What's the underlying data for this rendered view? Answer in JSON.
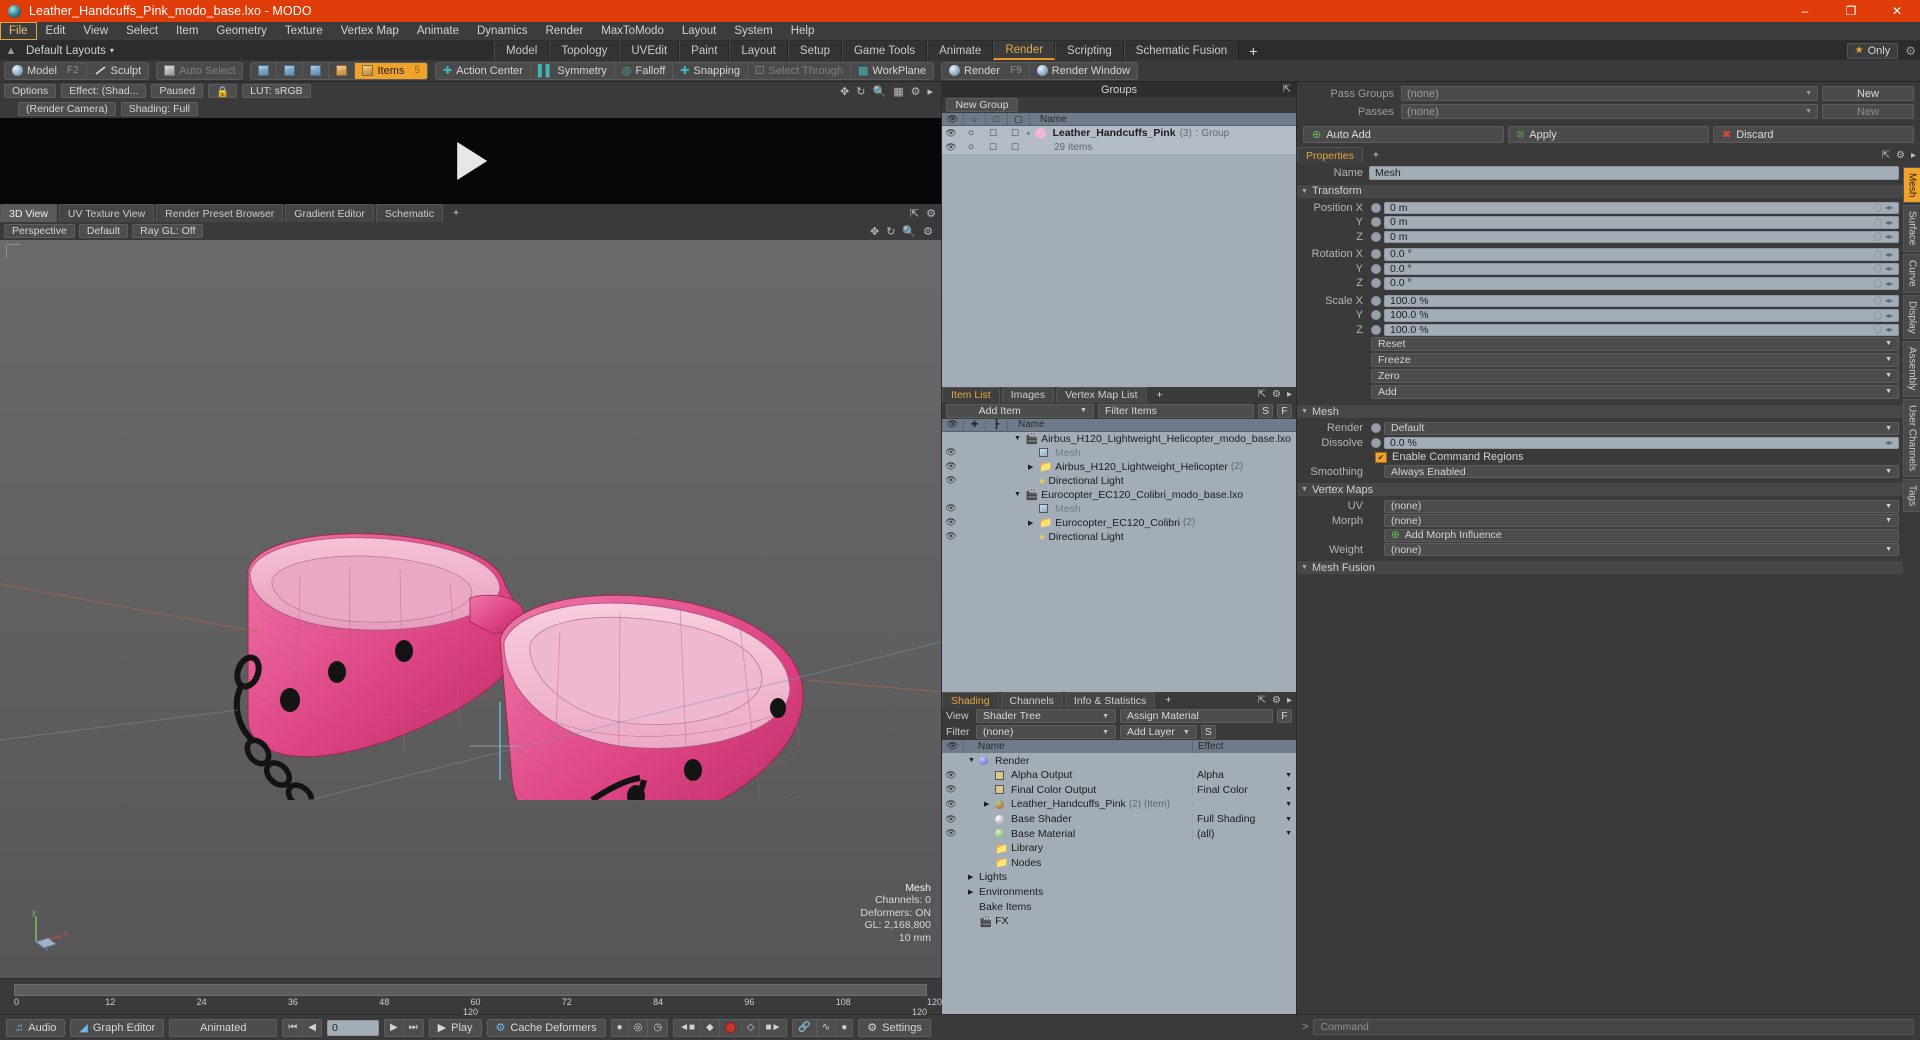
{
  "window": {
    "title": "Leather_Handcuffs_Pink_modo_base.lxo - MODO",
    "minimize": "–",
    "maximize": "❐",
    "close": "✕"
  },
  "menu": {
    "items": [
      "File",
      "Edit",
      "View",
      "Select",
      "Item",
      "Geometry",
      "Texture",
      "Vertex Map",
      "Animate",
      "Dynamics",
      "Render",
      "MaxToModo",
      "Layout",
      "System",
      "Help"
    ],
    "active": "File"
  },
  "layoutbar": {
    "home_icon": "home-icon",
    "label": "Default Layouts",
    "caret": "▾",
    "tabs": [
      "Model",
      "Topology",
      "UVEdit",
      "Paint",
      "Layout",
      "Setup",
      "Game Tools",
      "Animate",
      "Render",
      "Scripting",
      "Schematic Fusion"
    ],
    "selected_tab": "Render",
    "add_tab": "+",
    "only_label": "Only",
    "star": "★",
    "gear": "⚙"
  },
  "modebar": {
    "model": "Model",
    "model_key": "F2",
    "sculpt": "Sculpt",
    "auto_select": "Auto Select",
    "items": "Items",
    "items_key": "5",
    "action_center": "Action Center",
    "symmetry": "Symmetry",
    "falloff": "Falloff",
    "snapping": "Snapping",
    "select_through": "Select Through",
    "workplane": "WorkPlane",
    "render": "Render",
    "render_key": "F9",
    "render_window": "Render Window"
  },
  "preview": {
    "options": "Options",
    "effect": "Effect: (Shad...",
    "paused": "Paused",
    "lut": "LUT: sRGB",
    "render_camera": "(Render Camera)",
    "shading": "Shading: Full",
    "icons": [
      "move-icon",
      "rotate-icon",
      "zoom-icon",
      "grid-icon",
      "gear-icon",
      "arrow-icon"
    ]
  },
  "viewtabs": {
    "tabs": [
      "3D View",
      "UV Texture View",
      "Render Preset Browser",
      "Gradient Editor",
      "Schematic"
    ],
    "selected": "3D View",
    "add": "+"
  },
  "viewportbar": {
    "perspective": "Perspective",
    "default": "Default",
    "raygl": "Ray GL: Off",
    "icons": [
      "move-icon",
      "rotate-icon",
      "zoom-icon",
      "gear-icon"
    ]
  },
  "viewport_stats": {
    "title": "Mesh",
    "channels": "Channels: 0",
    "deformers": "Deformers: ON",
    "gl": "GL: 2,168,800",
    "scale": "10 mm",
    "axis_x": "x",
    "axis_y": "y",
    "axis_z": "z"
  },
  "timeline": {
    "ticks": [
      "0",
      "12",
      "24",
      "36",
      "48",
      "60",
      "72",
      "84",
      "96",
      "108",
      "120"
    ],
    "center_label": "120",
    "right_label": "120"
  },
  "groups_panel": {
    "title": "Groups",
    "new_group": "New Group",
    "columns": {
      "name": "Name"
    },
    "row": {
      "name": "Leather_Handcuffs_Pink",
      "count": "(3)",
      "type": ": Group",
      "sub": "29 Items"
    }
  },
  "item_list": {
    "tabs": [
      "Item List",
      "Images",
      "Vertex Map List"
    ],
    "selected": "Item List",
    "add": "+",
    "add_item": "Add Item",
    "filter_placeholder": "Filter Items",
    "btn_s": "S",
    "btn_f": "F",
    "columns": {
      "name": "Name"
    },
    "rows": [
      {
        "name": "Airbus_H120_Lightweight_Helicopter_modo_base.lxo",
        "kind": "scene",
        "indent": 0,
        "count": "",
        "dim": false,
        "eye": false,
        "tri": "▼"
      },
      {
        "name": "Mesh",
        "kind": "mesh",
        "indent": 1,
        "count": "",
        "dim": true,
        "eye": true,
        "tri": ""
      },
      {
        "name": "Airbus_H120_Lightweight_Helicopter",
        "kind": "folder",
        "indent": 1,
        "count": "(2)",
        "dim": false,
        "eye": true,
        "tri": "▶"
      },
      {
        "name": "Directional Light",
        "kind": "light",
        "indent": 1,
        "count": "",
        "dim": false,
        "eye": true,
        "tri": ""
      },
      {
        "name": "Eurocopter_EC120_Colibri_modo_base.lxo",
        "kind": "scene",
        "indent": 0,
        "count": "",
        "dim": false,
        "eye": false,
        "tri": "▼"
      },
      {
        "name": "Mesh",
        "kind": "mesh",
        "indent": 1,
        "count": "",
        "dim": true,
        "eye": true,
        "tri": ""
      },
      {
        "name": "Eurocopter_EC120_Colibri",
        "kind": "folder",
        "indent": 1,
        "count": "(2)",
        "dim": false,
        "eye": true,
        "tri": "▶"
      },
      {
        "name": "Directional Light",
        "kind": "light",
        "indent": 1,
        "count": "",
        "dim": false,
        "eye": true,
        "tri": ""
      }
    ]
  },
  "shading_panel": {
    "tabs": [
      "Shading",
      "Channels",
      "Info & Statistics"
    ],
    "selected": "Shading",
    "add": "+",
    "view_label": "View",
    "view_value": "Shader Tree",
    "filter_label": "Filter",
    "filter_value": "(none)",
    "assign_material": "Assign Material",
    "add_layer": "Add Layer",
    "btn_f": "F",
    "btn_s": "S",
    "columns": {
      "name": "Name",
      "effect": "Effect"
    },
    "rows": [
      {
        "name": "Render",
        "effect": "",
        "indent": 0,
        "tri": "▼",
        "icon": "sphere-blue",
        "eye": false,
        "suffix": ""
      },
      {
        "name": "Alpha Output",
        "effect": "Alpha",
        "indent": 1,
        "tri": "",
        "icon": "image-out",
        "eye": true,
        "suffix": ""
      },
      {
        "name": "Final Color Output",
        "effect": "Final Color",
        "indent": 1,
        "tri": "",
        "icon": "image-out",
        "eye": true,
        "suffix": ""
      },
      {
        "name": "Leather_Handcuffs_Pink",
        "effect": "",
        "indent": 1,
        "tri": "▶",
        "icon": "sphere-red",
        "eye": true,
        "suffix": "(2) (Item)"
      },
      {
        "name": "Base Shader",
        "effect": "Full Shading",
        "indent": 1,
        "tri": "",
        "icon": "sphere-white",
        "eye": true,
        "suffix": ""
      },
      {
        "name": "Base Material",
        "effect": "(all)",
        "indent": 1,
        "tri": "",
        "icon": "sphere-green",
        "eye": true,
        "suffix": ""
      },
      {
        "name": "Library",
        "effect": "",
        "indent": 1,
        "tri": "",
        "icon": "folder",
        "eye": false,
        "suffix": ""
      },
      {
        "name": "Nodes",
        "effect": "",
        "indent": 1,
        "tri": "",
        "icon": "folder",
        "eye": false,
        "suffix": ""
      },
      {
        "name": "Lights",
        "effect": "",
        "indent": 0,
        "tri": "▶",
        "icon": "",
        "eye": false,
        "suffix": ""
      },
      {
        "name": "Environments",
        "effect": "",
        "indent": 0,
        "tri": "▶",
        "icon": "",
        "eye": false,
        "suffix": ""
      },
      {
        "name": "Bake Items",
        "effect": "",
        "indent": 0,
        "tri": "",
        "icon": "",
        "eye": false,
        "suffix": ""
      },
      {
        "name": "FX",
        "effect": "",
        "indent": 0,
        "tri": "",
        "icon": "clapper",
        "eye": false,
        "suffix": ""
      }
    ]
  },
  "passes": {
    "pass_groups_label": "Pass Groups",
    "pass_groups_value": "(none)",
    "pass_groups_new": "New",
    "passes_label": "Passes",
    "passes_value": "(none)",
    "passes_new": "New",
    "auto_add": "Auto Add",
    "apply": "Apply",
    "discard": "Discard"
  },
  "properties": {
    "tabs": [
      "Properties"
    ],
    "selected": "Properties",
    "add": "+",
    "name_label": "Name",
    "name_value": "Mesh",
    "transform_header": "Transform",
    "transform_rows": [
      {
        "label": "Position X",
        "value": "0 m"
      },
      {
        "label": "Y",
        "value": "0 m"
      },
      {
        "label": "Z",
        "value": "0 m"
      },
      {
        "label": "Rotation X",
        "value": "0.0 °"
      },
      {
        "label": "Y",
        "value": "0.0 °"
      },
      {
        "label": "Z",
        "value": "0.0 °"
      },
      {
        "label": "Scale X",
        "value": "100.0 %"
      },
      {
        "label": "Y",
        "value": "100.0 %"
      },
      {
        "label": "Z",
        "value": "100.0 %"
      }
    ],
    "transform_dropdowns": [
      "Reset",
      "Freeze",
      "Zero",
      "Add"
    ],
    "mesh_header": "Mesh",
    "render_label": "Render",
    "render_value": "Default",
    "dissolve_label": "Dissolve",
    "dissolve_value": "0.0 %",
    "enable_cmd_regions": "Enable Command Regions",
    "smoothing_label": "Smoothing",
    "smoothing_value": "Always Enabled",
    "vertex_maps_header": "Vertex Maps",
    "uv_label": "UV",
    "uv_value": "(none)",
    "morph_label": "Morph",
    "morph_value": "(none)",
    "add_morph_influence": "Add Morph Influence",
    "weight_label": "Weight",
    "weight_value": "(none)",
    "mesh_fusion_header": "Mesh Fusion",
    "side_tabs": [
      "Mesh",
      "Surface",
      "Curve",
      "Display",
      "Assembly",
      "User Channels",
      "Tags"
    ],
    "side_selected": "Mesh"
  },
  "bottombar": {
    "audio": "Audio",
    "graph_editor": "Graph Editor",
    "animated": "Animated",
    "frame_value": "0",
    "play": "Play",
    "cache_deformers": "Cache Deformers",
    "settings": "Settings",
    "transport": [
      "⏮",
      "◀",
      "▶",
      "⏭"
    ],
    "command_placeholder": "Command",
    "command_prompt": ">"
  },
  "colors": {
    "title_bar": "#e03c0a",
    "accent": "#f0a32b",
    "panel_bg": "#3a3a3a",
    "list_bg": "#a3adb8",
    "handcuff_pink": "#e0488c"
  }
}
